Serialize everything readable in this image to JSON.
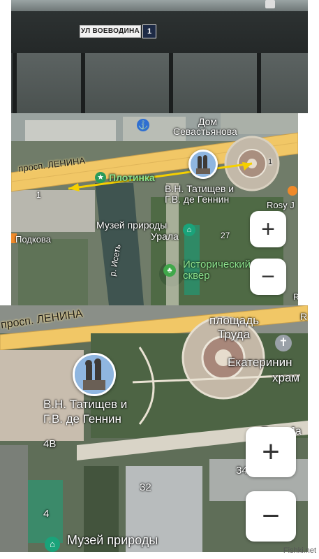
{
  "photo": {
    "street_sign": "УЛ ВОЕВОДИНА",
    "house_number": "1"
  },
  "map_top": {
    "labels": {
      "dom_line1": "Дом",
      "dom_line2": "Севастьянова",
      "prospekt": "просп. ЛЕНИНА",
      "plotinka": "Плотинка",
      "monument_line1": "В.Н. Татищев и",
      "monument_line2": "Г.В. де Геннин",
      "museum_line1": "Музей природы",
      "museum_line2": "Урала",
      "podkova": "Подкова",
      "sqver_line1": "Исторический",
      "sqver_line2": "сквер",
      "rosy": "Rosy J",
      "num_27": "27",
      "num_1_left": "1",
      "num_1_right": "1",
      "iset": "р. Исеть",
      "edge_r": "R"
    },
    "zoom_in": "+",
    "zoom_out": "−"
  },
  "map_bottom": {
    "labels": {
      "prospekt": "просп. ЛЕНИНА",
      "square_line1": "площадь",
      "square_line2": "Труда",
      "church_line1": "Екатеринин",
      "church_line2": "храм",
      "monument_line1": "В.Н. Татищев и",
      "monument_line2": "Г.В. де Геннин",
      "num_4v": "4В",
      "num_32": "32",
      "num_34": "34",
      "num_4": "4",
      "rosy": "Rosy Ja",
      "museum": "Музей природы",
      "edge_r": "R"
    },
    "zoom_in": "+",
    "zoom_out": "−"
  },
  "watermark": "Fishki.net",
  "colors": {
    "road": "#f1c766",
    "arrow": "#f5d000",
    "pin_ring": "#ffffff",
    "green_label": "#8de08d",
    "museum_pin": "#1aa37a",
    "poi_pin": "#2a9a5a"
  }
}
